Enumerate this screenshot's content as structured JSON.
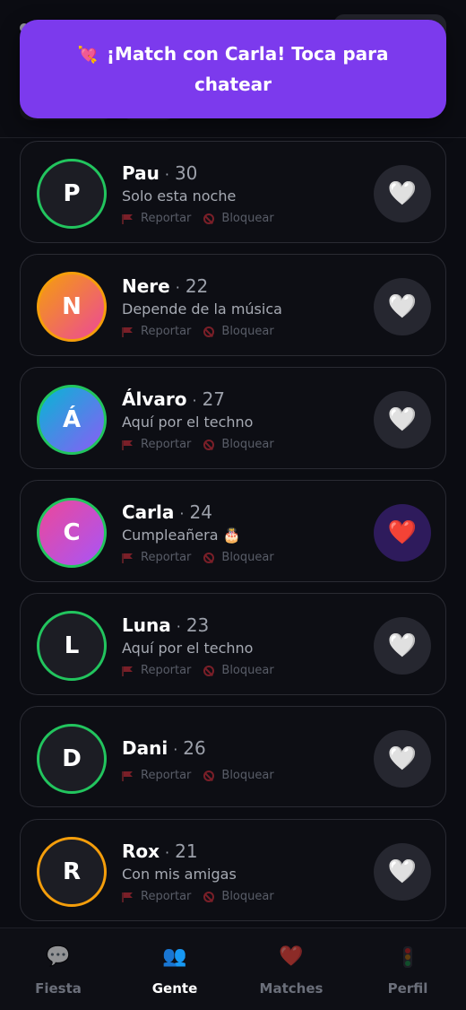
{
  "toast": {
    "emoji": "💘",
    "message": "¡Match con Carla! Toca para chatear"
  },
  "people": [
    {
      "initial": "P",
      "name": "Pau",
      "age": "30",
      "status": "Solo esta noche",
      "ring": "#22c55e",
      "bg": "#1c1d24",
      "liked": false
    },
    {
      "initial": "N",
      "name": "Nere",
      "age": "22",
      "status": "Depende de la música",
      "ring": "#f59e0b",
      "bg": "linear-gradient(135deg,#f59e0b,#ec4899)",
      "liked": false
    },
    {
      "initial": "Á",
      "name": "Álvaro",
      "age": "27",
      "status": "Aquí por el techno",
      "ring": "#22c55e",
      "bg": "linear-gradient(135deg,#06b6d4,#8b5cf6)",
      "liked": false
    },
    {
      "initial": "C",
      "name": "Carla",
      "age": "24",
      "status": "Cumpleañera 🎂",
      "ring": "#22c55e",
      "bg": "linear-gradient(135deg,#ec4899,#a855f7)",
      "liked": true
    },
    {
      "initial": "L",
      "name": "Luna",
      "age": "23",
      "status": "Aquí por el techno",
      "ring": "#22c55e",
      "bg": "#1c1d24",
      "liked": false
    },
    {
      "initial": "D",
      "name": "Dani",
      "age": "26",
      "status": "",
      "ring": "#22c55e",
      "bg": "#1c1d24",
      "liked": false
    },
    {
      "initial": "R",
      "name": "Rox",
      "age": "21",
      "status": "Con mis amigas",
      "ring": "#f59e0b",
      "bg": "#1c1d24",
      "liked": false
    }
  ],
  "actions": {
    "report_label": "Reportar",
    "block_label": "Bloquear"
  },
  "like_icons": {
    "default": "🤍",
    "liked": "❤️"
  },
  "nav": [
    {
      "label": "Fiesta",
      "icon": "chat-bubble-icon",
      "active": false
    },
    {
      "label": "Gente",
      "icon": "people-icon",
      "active": true
    },
    {
      "label": "Matches",
      "icon": "heart-icon",
      "active": false
    },
    {
      "label": "Perfil",
      "icon": "traffic-light-icon",
      "active": false
    }
  ]
}
